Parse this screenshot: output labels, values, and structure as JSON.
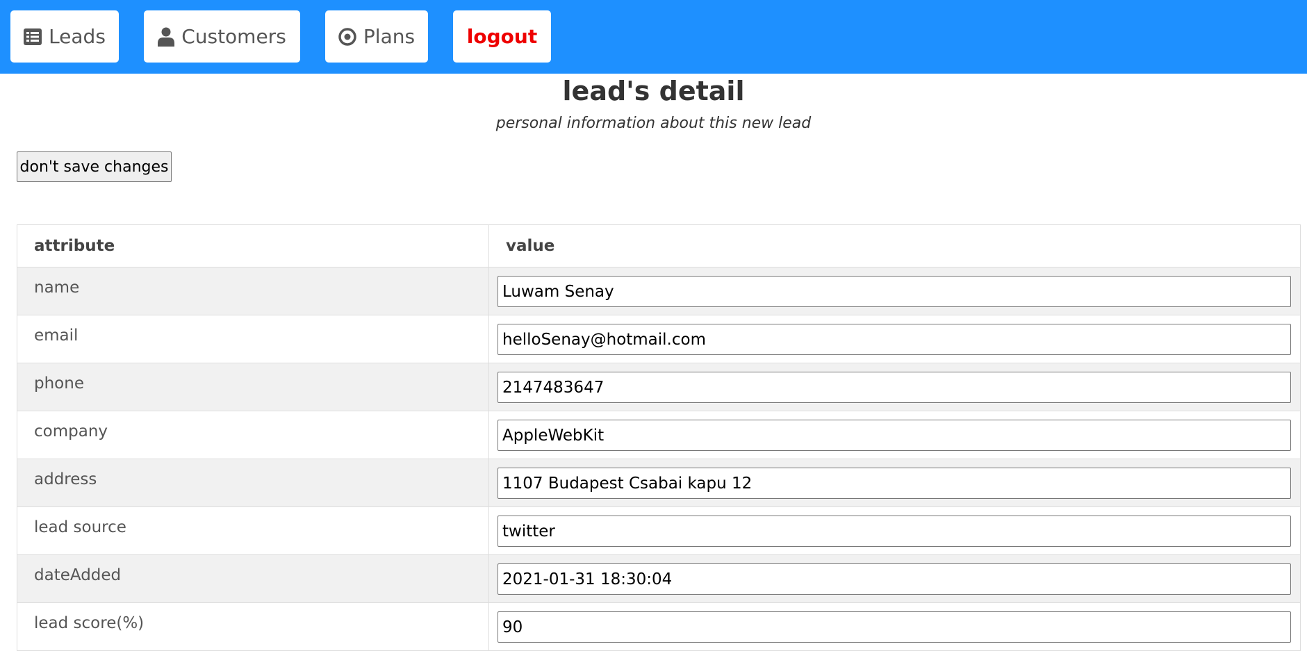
{
  "nav": {
    "leads_label": "Leads",
    "leads_icon": "list-icon",
    "customers_label": "Customers",
    "customers_icon": "user-icon",
    "plans_label": "Plans",
    "plans_icon": "target-icon",
    "logout_label": "logout"
  },
  "colors": {
    "navbar_bg": "#1e90ff",
    "logout_text": "#ee0000"
  },
  "page": {
    "title": "lead's detail",
    "subtitle": "personal information about this new lead",
    "dont_save_label": "don't save changes"
  },
  "table": {
    "headers": [
      "attribute",
      "value"
    ],
    "rows": [
      {
        "attribute": "name",
        "value": "Luwam Senay"
      },
      {
        "attribute": "email",
        "value": "helloSenay@hotmail.com"
      },
      {
        "attribute": "phone",
        "value": "2147483647"
      },
      {
        "attribute": "company",
        "value": "AppleWebKit"
      },
      {
        "attribute": "address",
        "value": "1107 Budapest Csabai kapu 12"
      },
      {
        "attribute": "lead source",
        "value": "twitter"
      },
      {
        "attribute": "dateAdded",
        "value": "2021-01-31 18:30:04"
      },
      {
        "attribute": "lead score(%)",
        "value": "90"
      }
    ]
  }
}
